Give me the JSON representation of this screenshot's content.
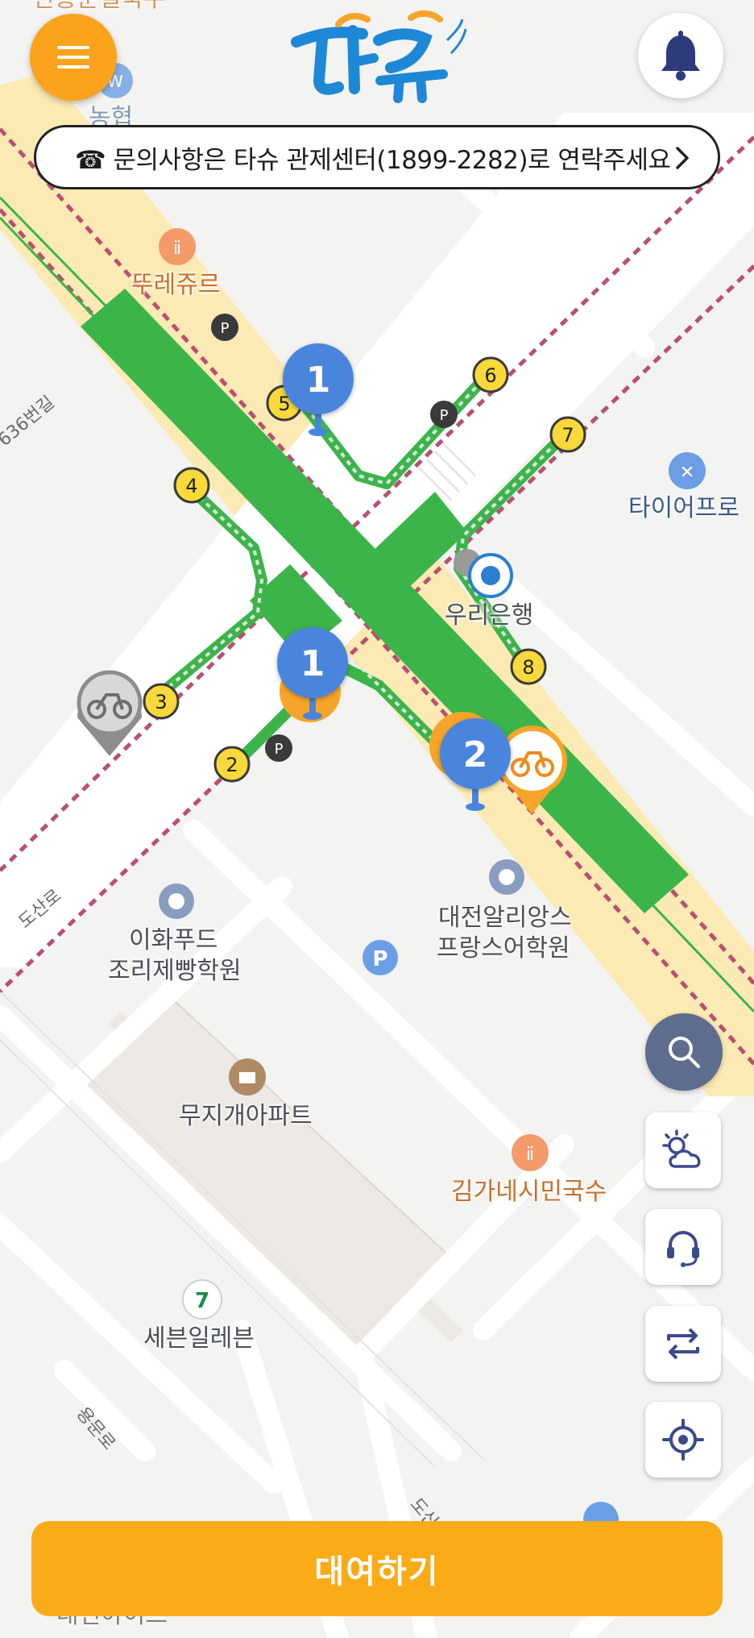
{
  "header": {
    "logo_alt": "타슈",
    "menu_icon": "hamburger-icon",
    "bell_icon": "bell-icon"
  },
  "notice": {
    "text": "☎ 문의사항은 타슈 관제센터(1899-2282)로 연락주세요",
    "chevron_icon": "chevron-right-icon"
  },
  "map": {
    "poi": {
      "ttourejour": "뚜레쥬르",
      "woori_bank": "우리은행",
      "tire_pro": "타이어프로",
      "ihwa_food_1": "이화푸드",
      "ihwa_food_2": "조리제빵학원",
      "alliance_1": "대전알리앙스",
      "alliance_2": "프랑스어학원",
      "mujigae_apt": "무지개아파트",
      "kimga_noodle": "김가네시민국수",
      "seven_eleven": "세븐일레븐",
      "nonghyup": "농협",
      "top_cut": "신흥분필국수",
      "bottom_cut": "대전아이프"
    },
    "roads": {
      "dosan_ro": "도산로",
      "r636": "636번길",
      "yongmun": "용문로",
      "dosan_bottom": "도산"
    },
    "crosswalk_numbers": [
      "1",
      "2",
      "3",
      "4",
      "5",
      "6",
      "7",
      "8"
    ],
    "station_markers": [
      {
        "count": "1"
      },
      {
        "count": "1"
      },
      {
        "count": "2"
      }
    ],
    "parking_label": "P",
    "colors": {
      "brand_orange": "#fba31c",
      "route_green": "#3bb54a",
      "marker_blue": "#4a85dd",
      "road_yellow": "#fbeab3"
    }
  },
  "side_buttons": {
    "search_icon": "search-icon",
    "weather_icon": "weather-icon",
    "support_icon": "headset-icon",
    "switch_icon": "swap-icon",
    "location_icon": "locate-icon"
  },
  "rent_button": {
    "label": "대여하기"
  }
}
